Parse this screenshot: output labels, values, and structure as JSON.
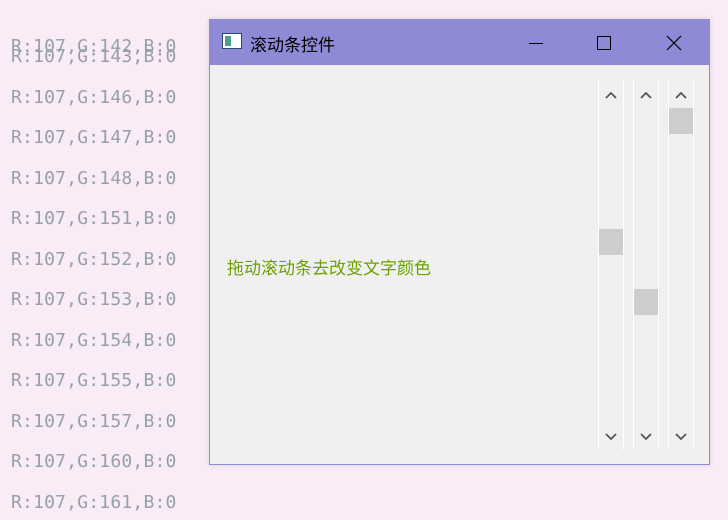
{
  "background_log": {
    "lines": [
      "R:107,G:142,B:0",
      "R:107,G:143,B:0",
      "R:107,G:146,B:0",
      "R:107,G:147,B:0",
      "R:107,G:148,B:0",
      "R:107,G:151,B:0",
      "R:107,G:152,B:0",
      "R:107,G:153,B:0",
      "R:107,G:154,B:0",
      "R:107,G:155,B:0",
      "R:107,G:157,B:0",
      "R:107,G:160,B:0",
      "R:107,G:161,B:0"
    ]
  },
  "window": {
    "title": "滚动条控件",
    "title_bar_color": "#8e8ad6",
    "icon": "app-window-icon",
    "controls": {
      "minimize_icon": "minimize-icon",
      "maximize_icon": "maximize-icon",
      "close_icon": "close-icon"
    }
  },
  "content": {
    "label": "拖动滚动条去改变文字颜色",
    "label_color": "#6ba100",
    "scrollbars": [
      {
        "name": "scrollbar-red",
        "channel": "R",
        "value": 107,
        "max": 255,
        "position_fraction": 0.42
      },
      {
        "name": "scrollbar-green",
        "channel": "G",
        "value": 161,
        "max": 255,
        "position_fraction": 0.63
      },
      {
        "name": "scrollbar-blue",
        "channel": "B",
        "value": 0,
        "max": 255,
        "position_fraction": 0.0
      }
    ],
    "scrollbar_icons": {
      "up": "chevron-up-icon",
      "down": "chevron-down-icon"
    }
  }
}
